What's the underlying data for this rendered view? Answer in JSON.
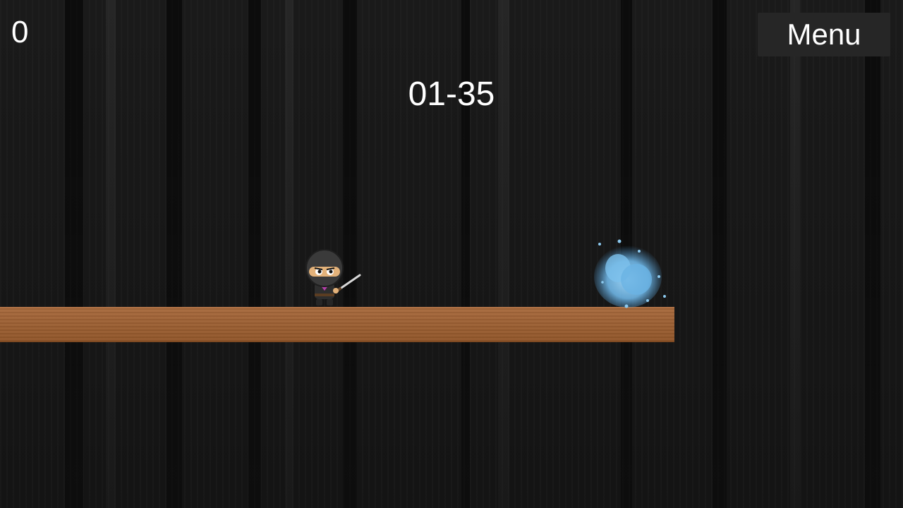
{
  "hud": {
    "score": "0",
    "timer": "01-35",
    "menu_label": "Menu"
  },
  "colors": {
    "background": "#171717",
    "platform": "#9b5f33",
    "spirit": "#6fb6e6",
    "text": "#ffffff",
    "menu_button": "#262626"
  },
  "entities": {
    "player": "ninja-character",
    "enemy": "blue-spirit-blob"
  }
}
